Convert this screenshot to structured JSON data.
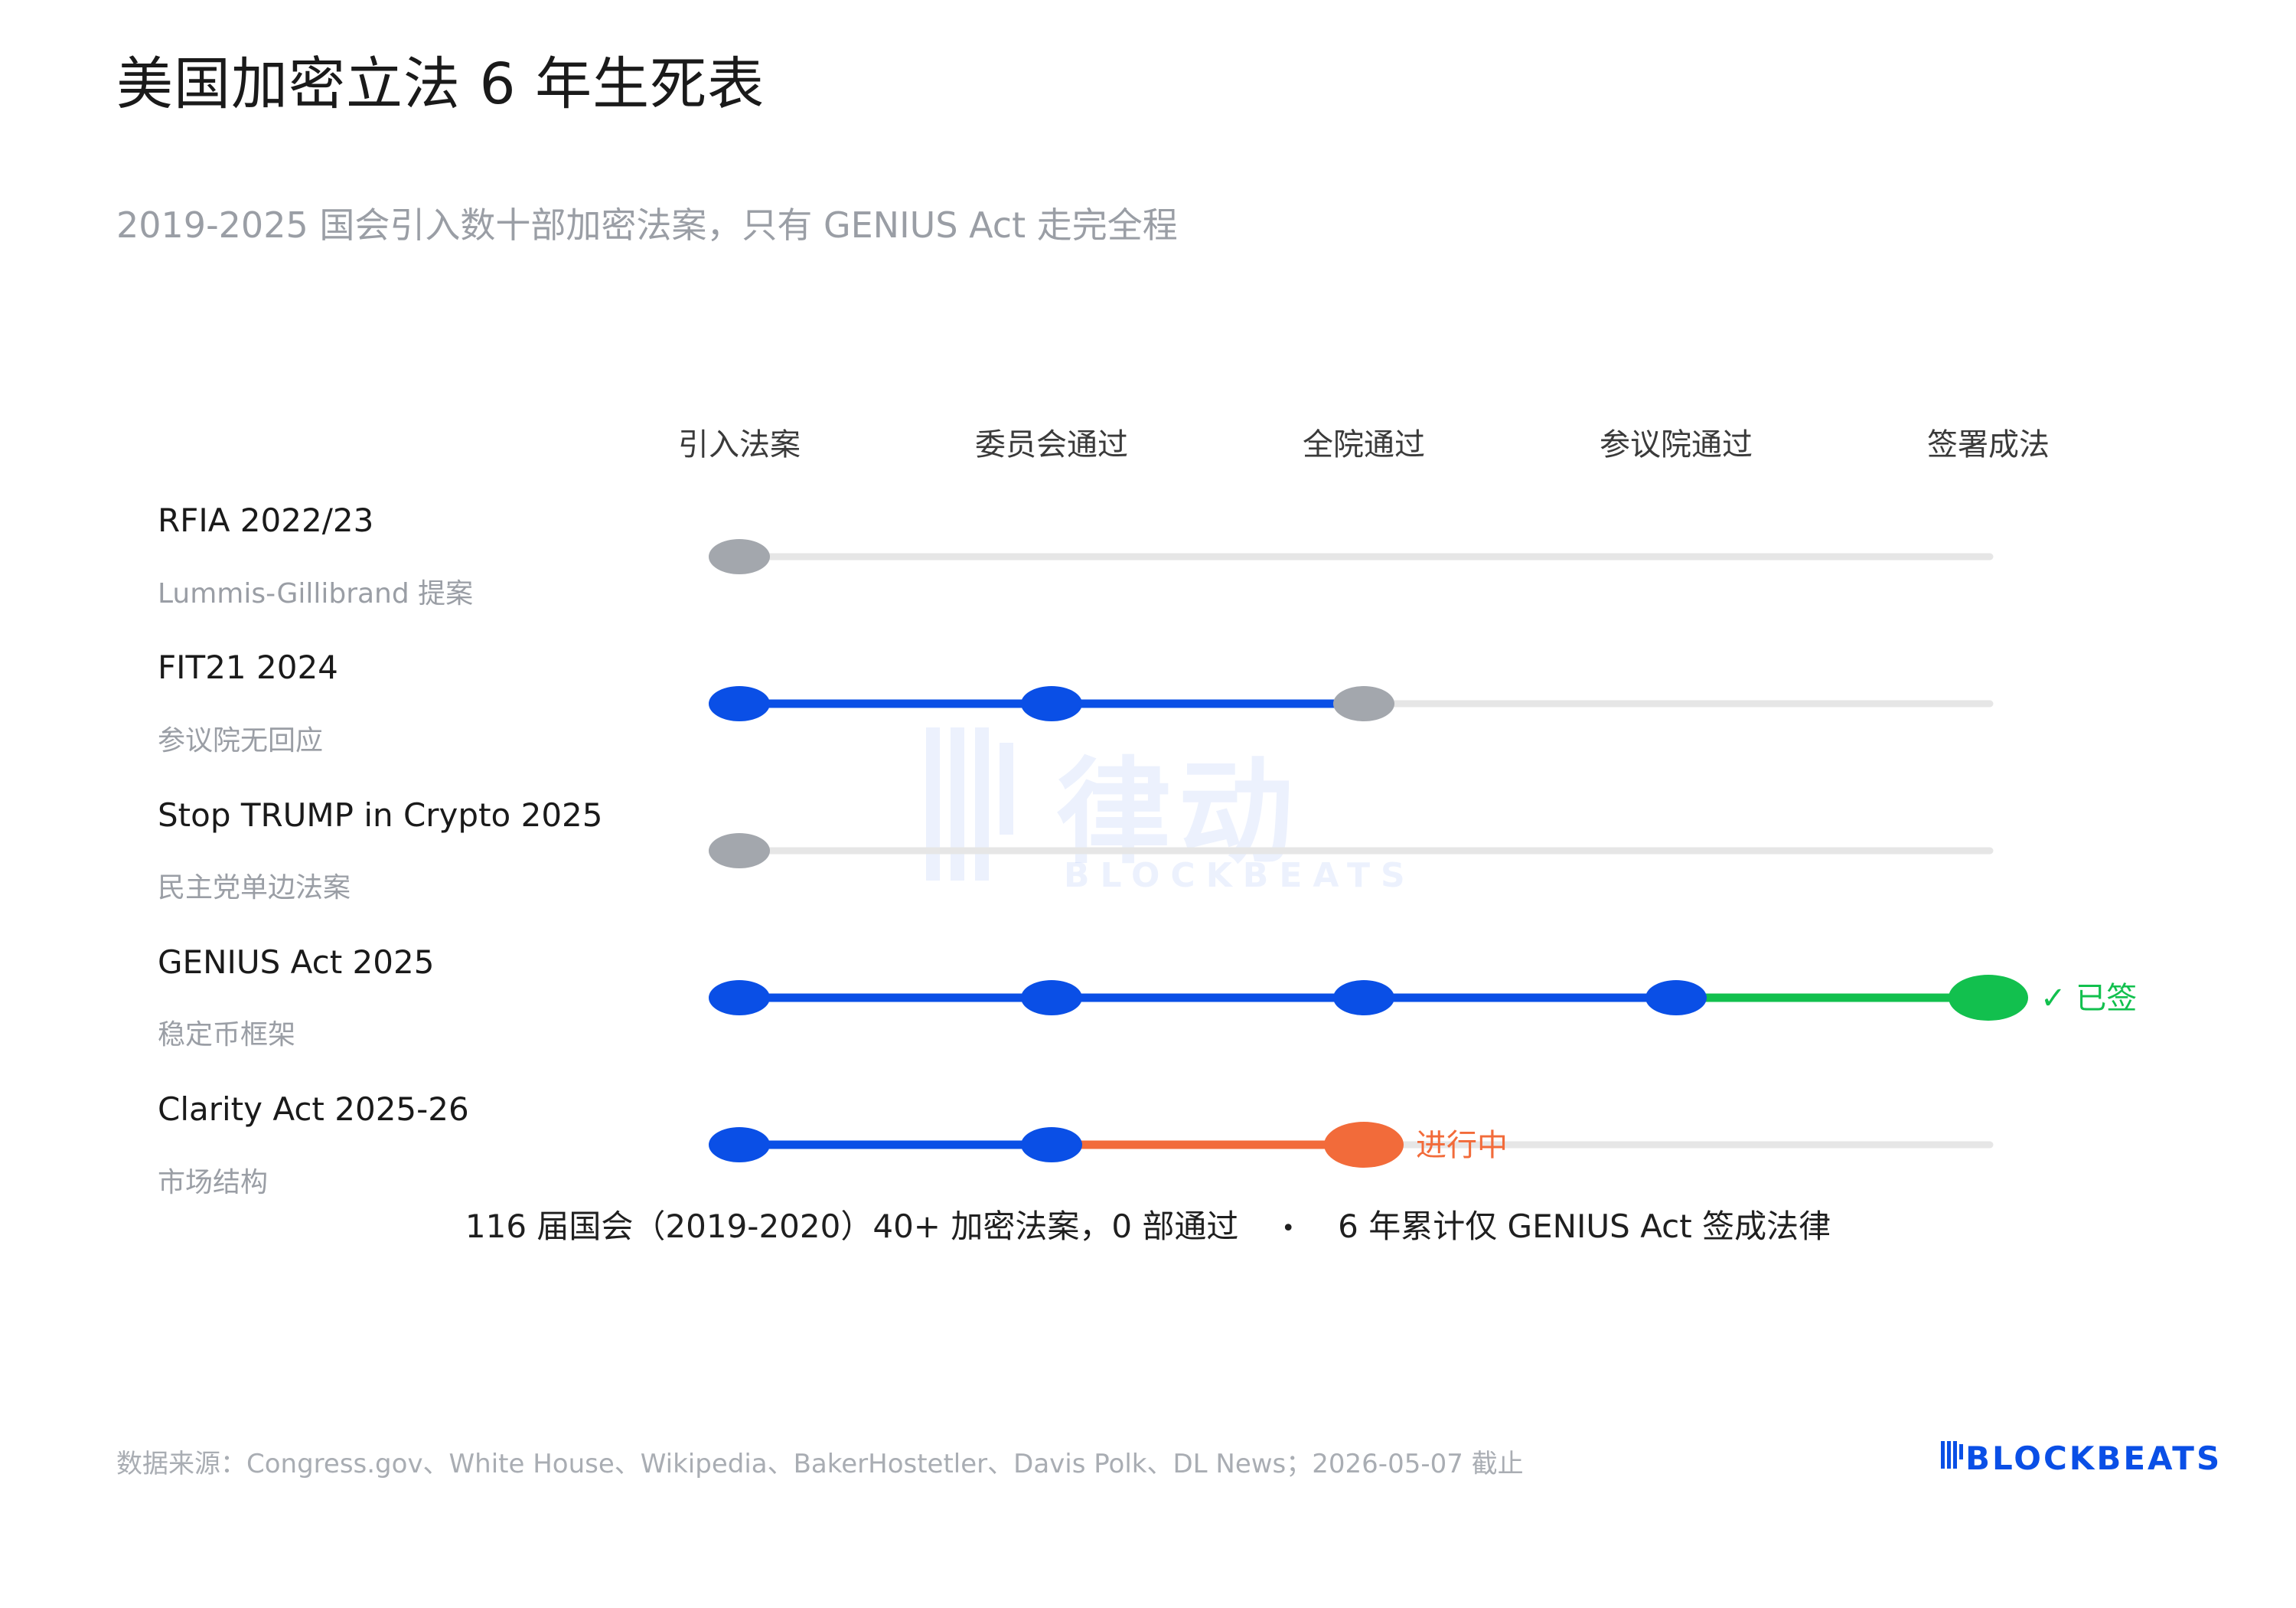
{
  "title": "美国加密立法 6 年生死表",
  "subtitle": "2019-2025 国会引入数十部加密法案，只有 GENIUS Act 走完全程",
  "stages": [
    "引入法案",
    "委员会通过",
    "全院通过",
    "参议院通过",
    "签署成法"
  ],
  "bills": [
    {
      "name": "RFIA  2022/23",
      "note": "Lummis-Gillibrand 提案",
      "reached": 1,
      "status": "stalled",
      "status_label": ""
    },
    {
      "name": "FIT21  2024",
      "note": "参议院无回应",
      "reached": 3,
      "status": "stalled",
      "status_label": ""
    },
    {
      "name": "Stop TRUMP in Crypto  2025",
      "note": "民主党单边法案",
      "reached": 1,
      "status": "stalled",
      "status_label": ""
    },
    {
      "name": "GENIUS Act  2025",
      "note": "稳定币框架",
      "reached": 5,
      "status": "signed",
      "status_label": "✓ 已签"
    },
    {
      "name": "Clarity Act  2025-26",
      "note": "市场结构",
      "reached": 3,
      "status": "in_progress",
      "status_label": "进行中"
    }
  ],
  "colors": {
    "passed": "#0a4fe6",
    "stalled": "#a3a7ad",
    "track": "#e6e6e6",
    "signed": "#12c04e",
    "in_progress": "#f26b3a"
  },
  "summary": {
    "left": "116 届国会（2019-2020）40+ 加密法案，0 部通过",
    "separator": "•",
    "right": "6 年累计仅 GENIUS Act 签成法律"
  },
  "source": "数据来源：Congress.gov、White House、Wikipedia、BakerHostetler、Davis Polk、DL News；2026-05-07 截止",
  "brand": "BLOCKBEATS",
  "watermark": {
    "text": "律动",
    "sub": "BLOCKBEATS"
  }
}
